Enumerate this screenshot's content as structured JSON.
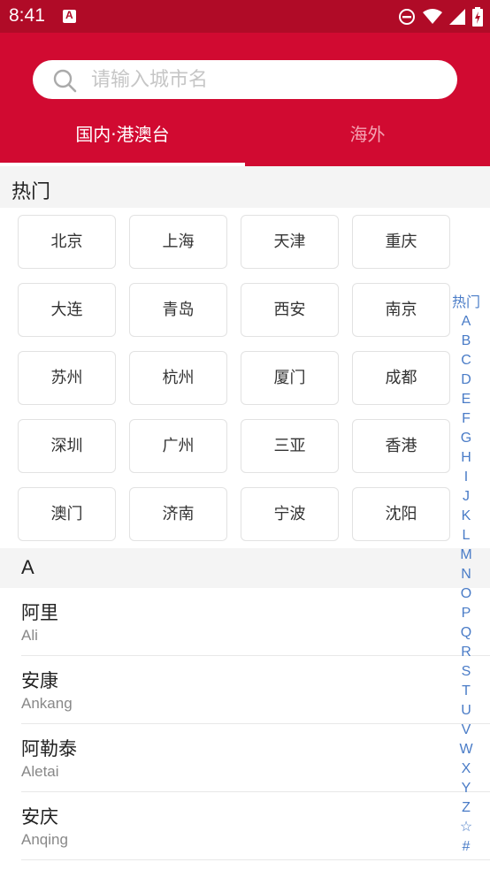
{
  "status_bar": {
    "time": "8:41",
    "icons": [
      "app-notification-icon",
      "do-not-disturb-icon",
      "wifi-icon",
      "cell-signal-icon",
      "battery-charging-icon"
    ]
  },
  "search": {
    "placeholder": "请输入城市名"
  },
  "tabs": [
    {
      "label": "国内·港澳台",
      "active": true
    },
    {
      "label": "海外",
      "active": false
    }
  ],
  "hot_section": {
    "title": "热门",
    "cities": [
      "北京",
      "上海",
      "天津",
      "重庆",
      "大连",
      "青岛",
      "西安",
      "南京",
      "苏州",
      "杭州",
      "厦门",
      "成都",
      "深圳",
      "广州",
      "三亚",
      "香港",
      "澳门",
      "济南",
      "宁波",
      "沈阳"
    ]
  },
  "letter_section": {
    "letter": "A",
    "cities": [
      {
        "name": "阿里",
        "pinyin": "Ali"
      },
      {
        "name": "安康",
        "pinyin": "Ankang"
      },
      {
        "name": "阿勒泰",
        "pinyin": "Aletai"
      },
      {
        "name": "安庆",
        "pinyin": "Anqing"
      }
    ]
  },
  "index_bar": [
    "热门",
    "A",
    "B",
    "C",
    "D",
    "E",
    "F",
    "G",
    "H",
    "I",
    "J",
    "K",
    "L",
    "M",
    "N",
    "O",
    "P",
    "Q",
    "R",
    "S",
    "T",
    "U",
    "V",
    "W",
    "X",
    "Y",
    "Z",
    "☆",
    "#"
  ],
  "colors": {
    "header_red": "#d10a31",
    "status_red": "#b00b27",
    "index_blue": "#4a7cc7"
  }
}
